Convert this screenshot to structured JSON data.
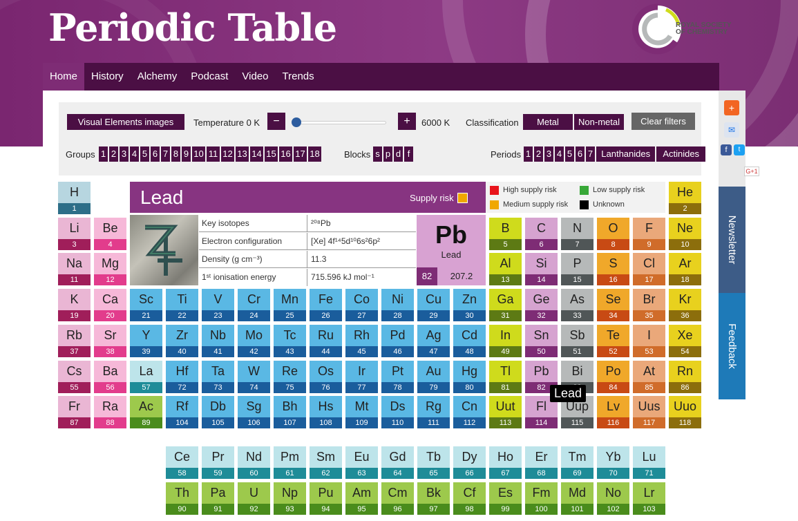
{
  "header": {
    "title": "Periodic Table",
    "logo_text": [
      "ROYAL SOCIETY",
      "OF CHEMISTRY"
    ]
  },
  "nav": [
    "Home",
    "History",
    "Alchemy",
    "Podcast",
    "Video",
    "Trends"
  ],
  "filters": {
    "visual_button": "Visual Elements images",
    "temperature_label": "Temperature 0 K",
    "minus": "−",
    "plus": "+",
    "temperature_max": "6000 K",
    "classification_label": "Classification",
    "metal": "Metal",
    "nonmetal": "Non-metal",
    "clear": "Clear filters",
    "groups_label": "Groups",
    "groups": [
      "1",
      "2",
      "3",
      "4",
      "5",
      "6",
      "7",
      "8",
      "9",
      "10",
      "11",
      "12",
      "13",
      "14",
      "15",
      "16",
      "17",
      "18"
    ],
    "blocks_label": "Blocks",
    "blocks": [
      "s",
      "p",
      "d",
      "f"
    ],
    "periods_label": "Periods",
    "periods": [
      "1",
      "2",
      "3",
      "4",
      "5",
      "6",
      "7",
      "Lanthanides",
      "Actinides"
    ]
  },
  "detail": {
    "name": "Lead",
    "supply_risk_label": "Supply risk",
    "legend": [
      "High supply risk",
      "Low supply risk",
      "Medium supply risk",
      "Unknown"
    ],
    "legend_colors": [
      "#e8141c",
      "#38a838",
      "#f0a800",
      "#000000"
    ],
    "props": [
      {
        "key": "Key isotopes",
        "value": "²⁰⁸Pb"
      },
      {
        "key": "Electron configuration",
        "value": "[Xe] 4f¹⁴5d¹⁰6s²6p²"
      },
      {
        "key": "Density (g cm⁻³)",
        "value": "11.3"
      },
      {
        "key": "1ˢᵗ ionisation energy",
        "value": "715.596 kJ mol⁻¹"
      }
    ],
    "symbol": "Pb",
    "element_name": "Lead",
    "atomic_number": "82",
    "atomic_mass": "207.2"
  },
  "tooltip": "Lead",
  "sidebar": {
    "newsletter": "Newsletter",
    "feedback": "Feedback",
    "gplus": "G+1"
  },
  "category_colors": {
    "nm": [
      "#b7d6e0",
      "#2d6e88"
    ],
    "alk": [
      "#eab6d4",
      "#a01e5a"
    ],
    "ae": [
      "#f6b8d8",
      "#e23c8c"
    ],
    "tm": [
      "#5ab8e4",
      "#1a5d9c"
    ],
    "ptm": [
      "#cfdb1c",
      "#5d7a14"
    ],
    "met": [
      "#d6a3d0",
      "#7e2c75"
    ],
    "nob": [
      "#e8d11e",
      "#8c6e0c"
    ],
    "hal": [
      "#eaa87a",
      "#d06c2a"
    ],
    "chal": [
      "#f0a82a",
      "#c84a14"
    ],
    "sm": [
      "#b6b9b9",
      "#505657"
    ],
    "lan": [
      "#bde4ea",
      "#1e8c98"
    ],
    "act": [
      "#9dc94c",
      "#4a8c1c"
    ],
    "unk": [
      "#cfdb1c",
      "#5d7a14"
    ]
  },
  "elements": [
    [
      "H",
      1,
      1,
      1,
      "nm"
    ],
    [
      "He",
      2,
      18,
      1,
      "nob"
    ],
    [
      "Li",
      3,
      1,
      2,
      "alk"
    ],
    [
      "Be",
      4,
      2,
      2,
      "ae"
    ],
    [
      "B",
      5,
      13,
      2,
      "ptm"
    ],
    [
      "C",
      6,
      14,
      2,
      "met"
    ],
    [
      "N",
      7,
      15,
      2,
      "sm"
    ],
    [
      "O",
      8,
      16,
      2,
      "chal"
    ],
    [
      "F",
      9,
      17,
      2,
      "hal"
    ],
    [
      "Ne",
      10,
      18,
      2,
      "nob"
    ],
    [
      "Na",
      11,
      1,
      3,
      "alk"
    ],
    [
      "Mg",
      12,
      2,
      3,
      "ae"
    ],
    [
      "Al",
      13,
      13,
      3,
      "ptm"
    ],
    [
      "Si",
      14,
      14,
      3,
      "met"
    ],
    [
      "P",
      15,
      15,
      3,
      "sm"
    ],
    [
      "S",
      16,
      16,
      3,
      "chal"
    ],
    [
      "Cl",
      17,
      17,
      3,
      "hal"
    ],
    [
      "Ar",
      18,
      18,
      3,
      "nob"
    ],
    [
      "K",
      19,
      1,
      4,
      "alk"
    ],
    [
      "Ca",
      20,
      2,
      4,
      "ae"
    ],
    [
      "Sc",
      21,
      3,
      4,
      "tm"
    ],
    [
      "Ti",
      22,
      4,
      4,
      "tm"
    ],
    [
      "V",
      23,
      5,
      4,
      "tm"
    ],
    [
      "Cr",
      24,
      6,
      4,
      "tm"
    ],
    [
      "Mn",
      25,
      7,
      4,
      "tm"
    ],
    [
      "Fe",
      26,
      8,
      4,
      "tm"
    ],
    [
      "Co",
      27,
      9,
      4,
      "tm"
    ],
    [
      "Ni",
      28,
      10,
      4,
      "tm"
    ],
    [
      "Cu",
      29,
      11,
      4,
      "tm"
    ],
    [
      "Zn",
      30,
      12,
      4,
      "tm"
    ],
    [
      "Ga",
      31,
      13,
      4,
      "ptm"
    ],
    [
      "Ge",
      32,
      14,
      4,
      "met"
    ],
    [
      "As",
      33,
      15,
      4,
      "sm"
    ],
    [
      "Se",
      34,
      16,
      4,
      "chal"
    ],
    [
      "Br",
      35,
      17,
      4,
      "hal"
    ],
    [
      "Kr",
      36,
      18,
      4,
      "nob"
    ],
    [
      "Rb",
      37,
      1,
      5,
      "alk"
    ],
    [
      "Sr",
      38,
      2,
      5,
      "ae"
    ],
    [
      "Y",
      39,
      3,
      5,
      "tm"
    ],
    [
      "Zr",
      40,
      4,
      5,
      "tm"
    ],
    [
      "Nb",
      41,
      5,
      5,
      "tm"
    ],
    [
      "Mo",
      42,
      6,
      5,
      "tm"
    ],
    [
      "Tc",
      43,
      7,
      5,
      "tm"
    ],
    [
      "Ru",
      44,
      8,
      5,
      "tm"
    ],
    [
      "Rh",
      45,
      9,
      5,
      "tm"
    ],
    [
      "Pd",
      46,
      10,
      5,
      "tm"
    ],
    [
      "Ag",
      47,
      11,
      5,
      "tm"
    ],
    [
      "Cd",
      48,
      12,
      5,
      "tm"
    ],
    [
      "In",
      49,
      13,
      5,
      "ptm"
    ],
    [
      "Sn",
      50,
      14,
      5,
      "met"
    ],
    [
      "Sb",
      51,
      15,
      5,
      "sm"
    ],
    [
      "Te",
      52,
      16,
      5,
      "chal"
    ],
    [
      "I",
      53,
      17,
      5,
      "hal"
    ],
    [
      "Xe",
      54,
      18,
      5,
      "nob"
    ],
    [
      "Cs",
      55,
      1,
      6,
      "alk"
    ],
    [
      "Ba",
      56,
      2,
      6,
      "ae"
    ],
    [
      "La",
      57,
      3,
      6,
      "lan"
    ],
    [
      "Hf",
      72,
      4,
      6,
      "tm"
    ],
    [
      "Ta",
      73,
      5,
      6,
      "tm"
    ],
    [
      "W",
      74,
      6,
      6,
      "tm"
    ],
    [
      "Re",
      75,
      7,
      6,
      "tm"
    ],
    [
      "Os",
      76,
      8,
      6,
      "tm"
    ],
    [
      "Ir",
      77,
      9,
      6,
      "tm"
    ],
    [
      "Pt",
      78,
      10,
      6,
      "tm"
    ],
    [
      "Au",
      79,
      11,
      6,
      "tm"
    ],
    [
      "Hg",
      80,
      12,
      6,
      "tm"
    ],
    [
      "Tl",
      81,
      13,
      6,
      "ptm"
    ],
    [
      "Pb",
      82,
      14,
      6,
      "met"
    ],
    [
      "Bi",
      83,
      15,
      6,
      "sm"
    ],
    [
      "Po",
      84,
      16,
      6,
      "chal"
    ],
    [
      "At",
      85,
      17,
      6,
      "hal"
    ],
    [
      "Rn",
      86,
      18,
      6,
      "nob"
    ],
    [
      "Fr",
      87,
      1,
      7,
      "alk"
    ],
    [
      "Ra",
      88,
      2,
      7,
      "ae"
    ],
    [
      "Ac",
      89,
      3,
      7,
      "act"
    ],
    [
      "Rf",
      104,
      4,
      7,
      "tm"
    ],
    [
      "Db",
      105,
      5,
      7,
      "tm"
    ],
    [
      "Sg",
      106,
      6,
      7,
      "tm"
    ],
    [
      "Bh",
      107,
      7,
      7,
      "tm"
    ],
    [
      "Hs",
      108,
      8,
      7,
      "tm"
    ],
    [
      "Mt",
      109,
      9,
      7,
      "tm"
    ],
    [
      "Ds",
      110,
      10,
      7,
      "tm"
    ],
    [
      "Rg",
      111,
      11,
      7,
      "tm"
    ],
    [
      "Cn",
      112,
      12,
      7,
      "tm"
    ],
    [
      "Uut",
      113,
      13,
      7,
      "unk"
    ],
    [
      "Fl",
      114,
      14,
      7,
      "met"
    ],
    [
      "Uup",
      115,
      15,
      7,
      "sm"
    ],
    [
      "Lv",
      116,
      16,
      7,
      "chal"
    ],
    [
      "Uus",
      117,
      17,
      7,
      "hal"
    ],
    [
      "Uuo",
      118,
      18,
      7,
      "nob"
    ],
    [
      "Ce",
      58,
      4,
      9,
      "lan"
    ],
    [
      "Pr",
      59,
      5,
      9,
      "lan"
    ],
    [
      "Nd",
      60,
      6,
      9,
      "lan"
    ],
    [
      "Pm",
      61,
      7,
      9,
      "lan"
    ],
    [
      "Sm",
      62,
      8,
      9,
      "lan"
    ],
    [
      "Eu",
      63,
      9,
      9,
      "lan"
    ],
    [
      "Gd",
      64,
      10,
      9,
      "lan"
    ],
    [
      "Tb",
      65,
      11,
      9,
      "lan"
    ],
    [
      "Dy",
      66,
      12,
      9,
      "lan"
    ],
    [
      "Ho",
      67,
      13,
      9,
      "lan"
    ],
    [
      "Er",
      68,
      14,
      9,
      "lan"
    ],
    [
      "Tm",
      69,
      15,
      9,
      "lan"
    ],
    [
      "Yb",
      70,
      16,
      9,
      "lan"
    ],
    [
      "Lu",
      71,
      17,
      9,
      "lan"
    ],
    [
      "Th",
      90,
      4,
      10,
      "act"
    ],
    [
      "Pa",
      91,
      5,
      10,
      "act"
    ],
    [
      "U",
      92,
      6,
      10,
      "act"
    ],
    [
      "Np",
      93,
      7,
      10,
      "act"
    ],
    [
      "Pu",
      94,
      8,
      10,
      "act"
    ],
    [
      "Am",
      95,
      9,
      10,
      "act"
    ],
    [
      "Cm",
      96,
      10,
      10,
      "act"
    ],
    [
      "Bk",
      97,
      11,
      10,
      "act"
    ],
    [
      "Cf",
      98,
      12,
      10,
      "act"
    ],
    [
      "Es",
      99,
      13,
      10,
      "act"
    ],
    [
      "Fm",
      100,
      14,
      10,
      "act"
    ],
    [
      "Md",
      101,
      15,
      10,
      "act"
    ],
    [
      "No",
      102,
      16,
      10,
      "act"
    ],
    [
      "Lr",
      103,
      17,
      10,
      "act"
    ]
  ]
}
